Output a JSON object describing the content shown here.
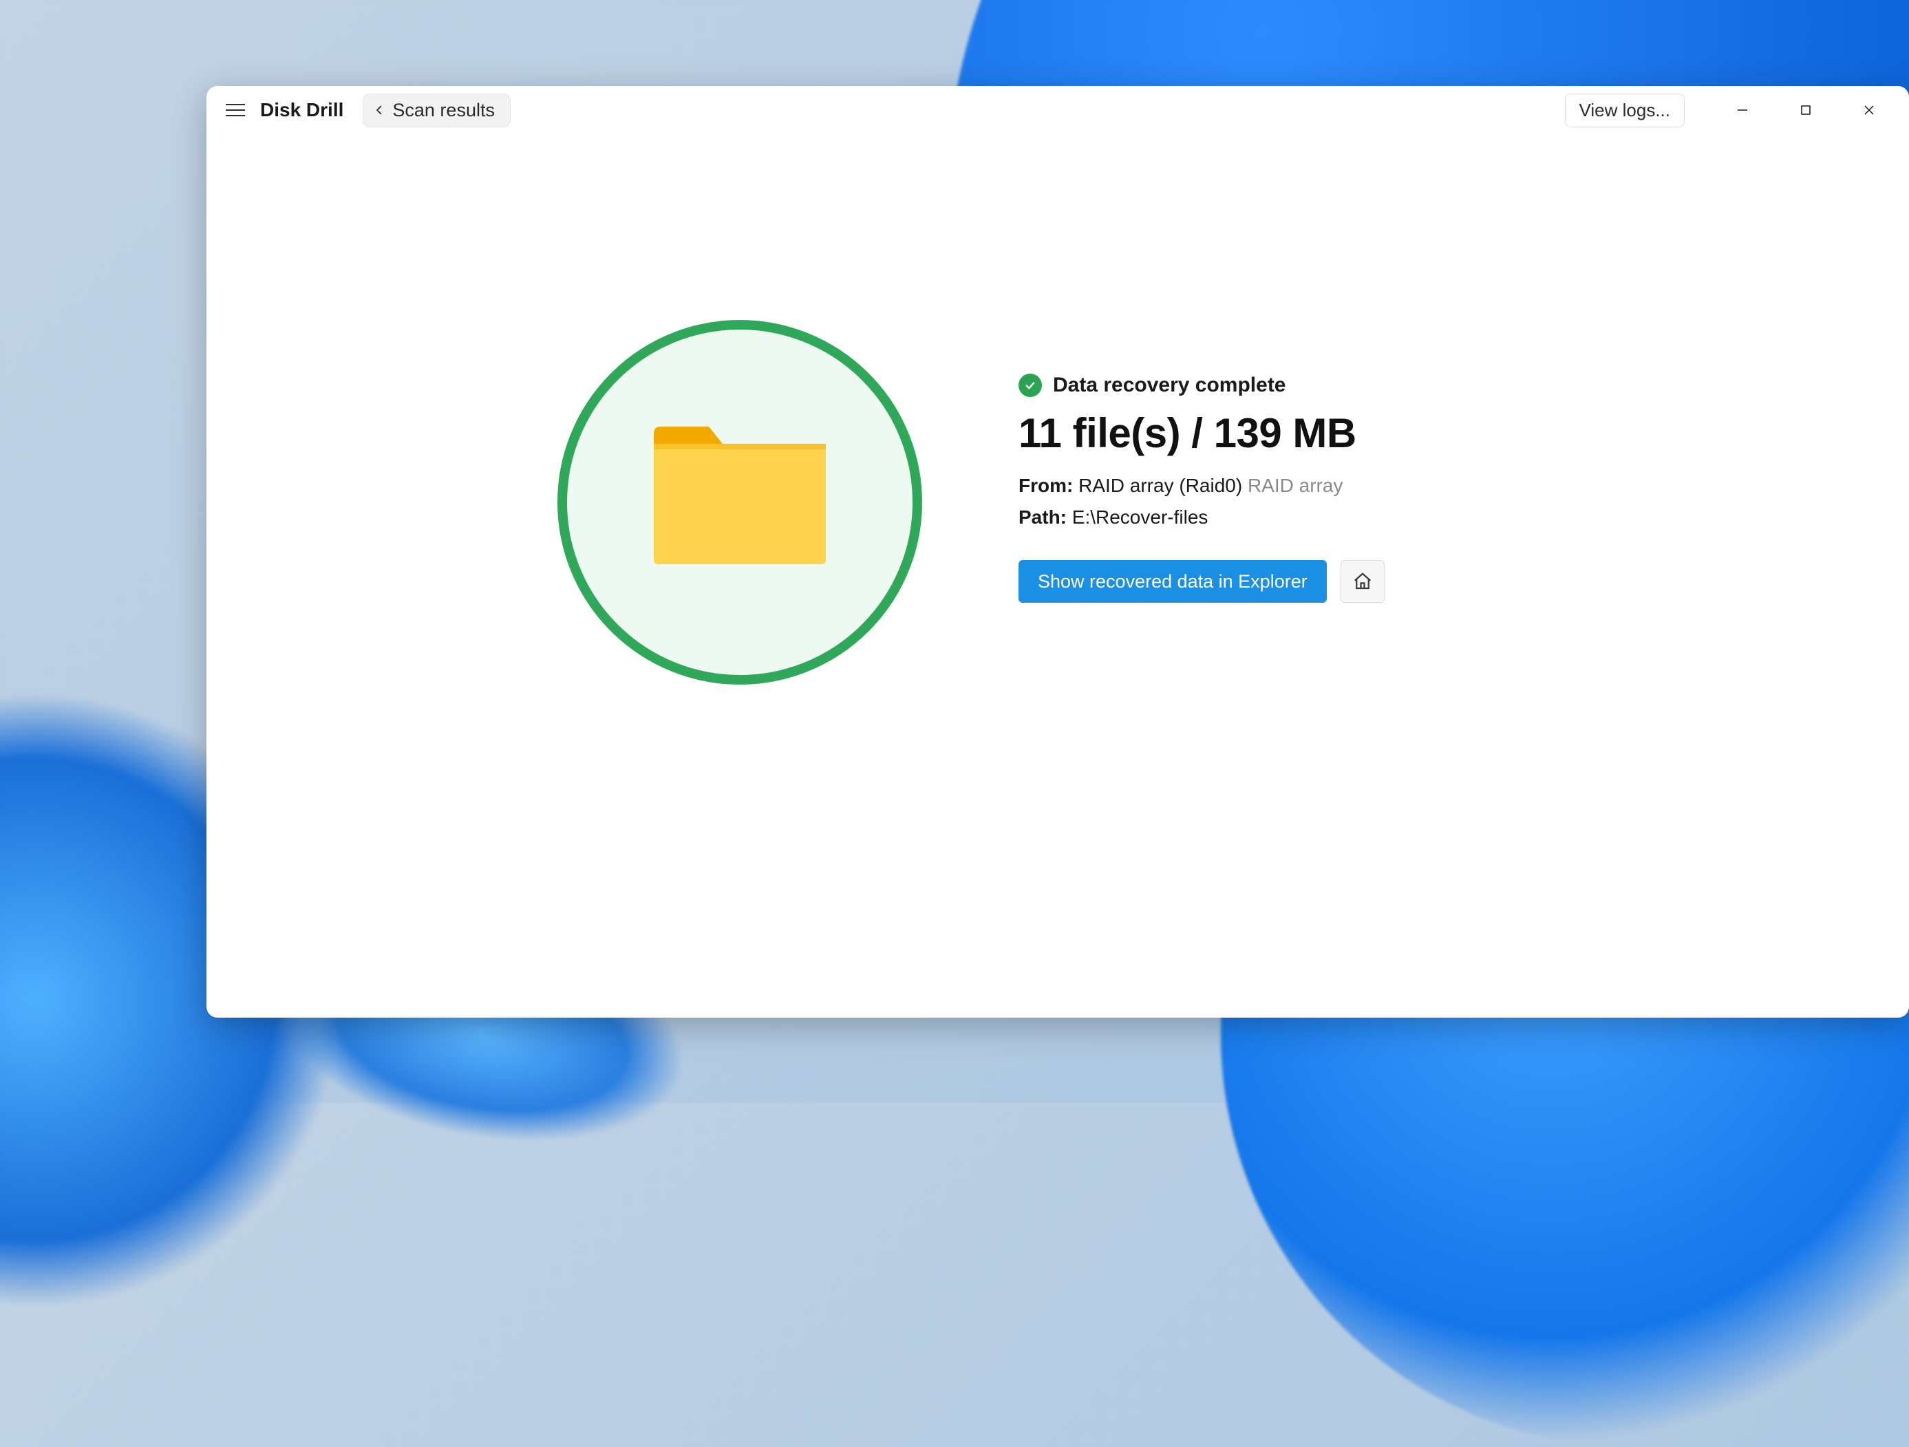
{
  "app": {
    "title": "Disk Drill"
  },
  "toolbar": {
    "back_label": "Scan results",
    "view_logs_label": "View logs..."
  },
  "result": {
    "status_text": "Data recovery complete",
    "summary": "11 file(s) / 139 MB",
    "from_label": "From:",
    "from_value": "RAID array (Raid0)",
    "from_secondary": "RAID array",
    "path_label": "Path:",
    "path_value": "E:\\Recover-files",
    "show_button": "Show recovered data in Explorer"
  }
}
